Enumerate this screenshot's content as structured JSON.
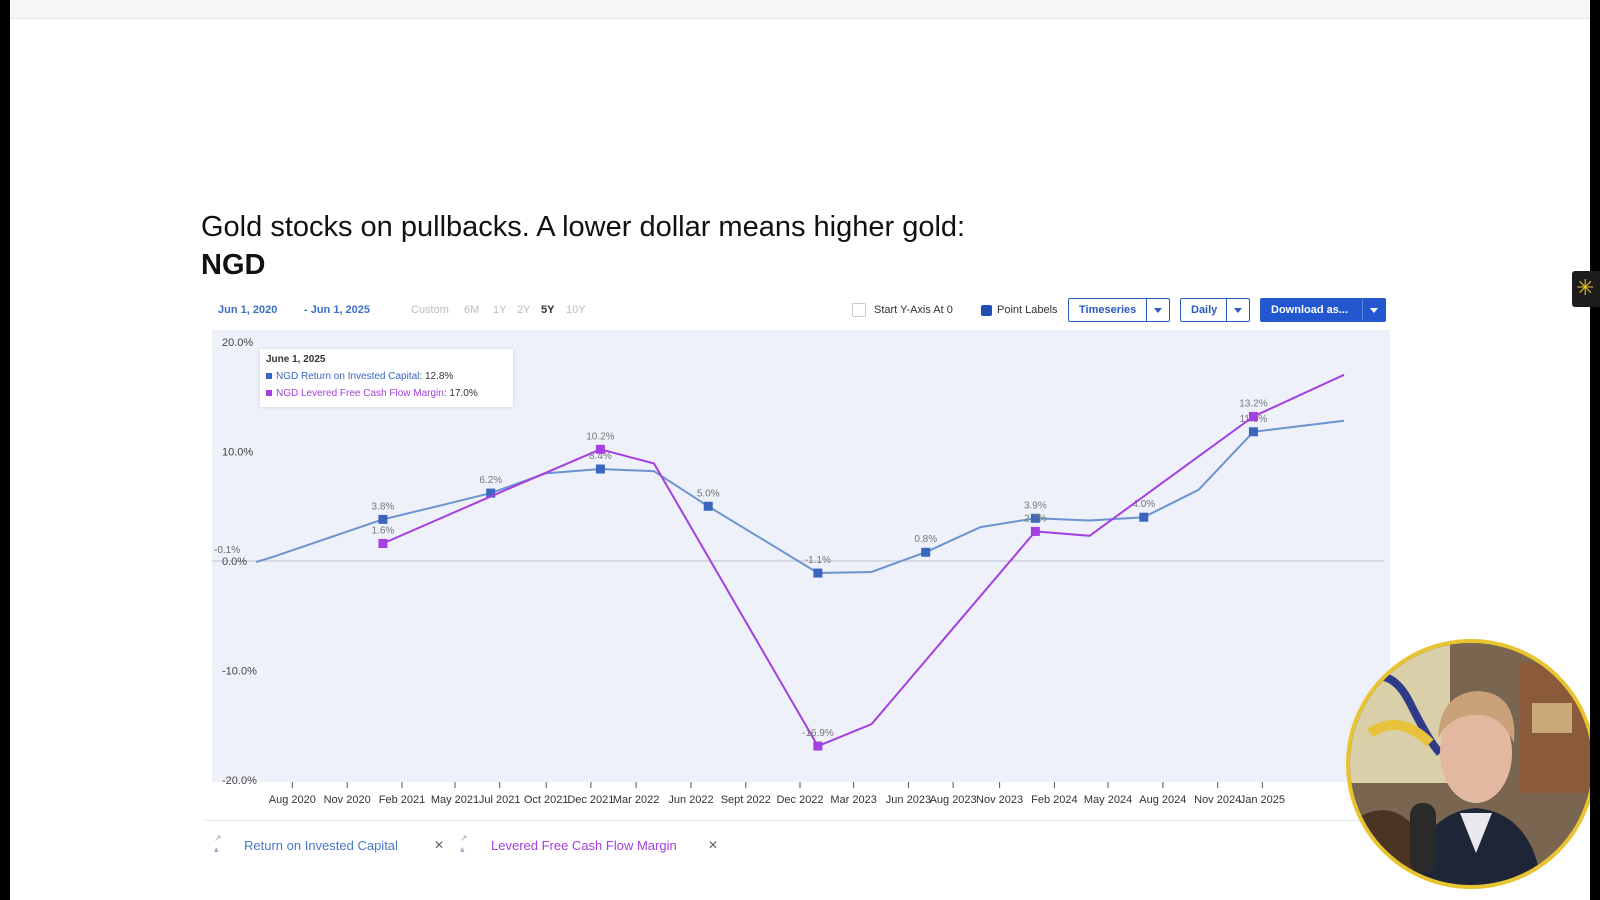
{
  "slide": {
    "headline": "Gold stocks on pullbacks.  A lower dollar means higher gold:",
    "ticker": "NGD"
  },
  "toolbar": {
    "date_start": "Jun 1, 2020",
    "date_end": "- Jun 1, 2025",
    "ranges": [
      {
        "label": "Custom",
        "active": false
      },
      {
        "label": "6M",
        "active": false
      },
      {
        "label": "1Y",
        "active": false
      },
      {
        "label": "2Y",
        "active": false
      },
      {
        "label": "5Y",
        "active": true
      },
      {
        "label": "10Y",
        "active": false
      }
    ],
    "start_y_axis_label": "Start Y-Axis At 0",
    "start_y_axis_checked": false,
    "point_labels_label": "Point Labels",
    "point_labels_checked": true,
    "view_mode": "Timeseries",
    "frequency": "Daily",
    "download": "Download as..."
  },
  "tooltip": {
    "date": "June 1, 2025",
    "rows": [
      {
        "name": "NGD Return on Invested Capital",
        "value": "12.8%"
      },
      {
        "name": "NGD Levered Free Cash Flow Margin",
        "value": "17.0%"
      }
    ]
  },
  "legend": [
    {
      "label": "Return on Invested Capital",
      "color": "#4a78c8"
    },
    {
      "label": "Levered Free Cash Flow Margin",
      "color": "#a43fe0"
    }
  ],
  "colors": {
    "roic": "#6b93cf",
    "roic_marker": "#3b66c0",
    "lfcf": "#a43fe0",
    "plot_bg": "#eef1f9",
    "accent": "#2257cf"
  },
  "icons": {
    "badge": "asterisk-icon",
    "close": "close-icon",
    "caret": "caret-down-icon"
  },
  "chart_data": {
    "type": "line",
    "xlim": [
      "2020-06-01",
      "2025-06-01"
    ],
    "ylim": [
      -20,
      20
    ],
    "yticks": [
      "20.0%",
      "10.0%",
      "0.0%",
      "-10.0%",
      "-20.0%"
    ],
    "xticks": [
      {
        "date": "2020-08-01",
        "label": "Aug 2020"
      },
      {
        "date": "2020-11-01",
        "label": "Nov 2020"
      },
      {
        "date": "2021-02-01",
        "label": "Feb 2021"
      },
      {
        "date": "2021-05-01",
        "label": "May 2021"
      },
      {
        "date": "2021-07-15",
        "label": "Jul 2021"
      },
      {
        "date": "2021-10-01",
        "label": "Oct 2021"
      },
      {
        "date": "2021-12-15",
        "label": "Dec 2021"
      },
      {
        "date": "2022-03-01",
        "label": "Mar 2022"
      },
      {
        "date": "2022-06-01",
        "label": "Jun 2022"
      },
      {
        "date": "2022-09-01",
        "label": "Sept 2022"
      },
      {
        "date": "2022-12-01",
        "label": "Dec 2022"
      },
      {
        "date": "2023-03-01",
        "label": "Mar 2023"
      },
      {
        "date": "2023-06-01",
        "label": "Jun 2023"
      },
      {
        "date": "2023-08-15",
        "label": "Aug 2023"
      },
      {
        "date": "2023-11-01",
        "label": "Nov 2023"
      },
      {
        "date": "2024-02-01",
        "label": "Feb 2024"
      },
      {
        "date": "2024-05-01",
        "label": "May 2024"
      },
      {
        "date": "2024-08-01",
        "label": "Aug 2024"
      },
      {
        "date": "2024-11-01",
        "label": "Nov 2024"
      },
      {
        "date": "2025-01-15",
        "label": "Jan 2025"
      }
    ],
    "series": [
      {
        "name": "Return on Invested Capital",
        "points": [
          {
            "x": "2020-06-01",
            "y": -0.1
          },
          {
            "x": "2020-07-01",
            "y": 0.4
          },
          {
            "x": "2020-12-31",
            "y": 3.8,
            "label": "3.8%",
            "marker": true
          },
          {
            "x": "2021-04-01",
            "y": 5.0
          },
          {
            "x": "2021-06-30",
            "y": 6.2,
            "label": "6.2%",
            "marker": true
          },
          {
            "x": "2021-09-30",
            "y": 8.0
          },
          {
            "x": "2021-12-31",
            "y": 8.4,
            "label": "8.4%",
            "marker": true
          },
          {
            "x": "2022-03-31",
            "y": 8.2
          },
          {
            "x": "2022-06-30",
            "y": 5.0,
            "label": "5.0%",
            "marker": true
          },
          {
            "x": "2022-12-31",
            "y": -1.1,
            "label": "-1.1%",
            "marker": true
          },
          {
            "x": "2023-03-31",
            "y": -1.0
          },
          {
            "x": "2023-06-30",
            "y": 0.8,
            "label": "0.8%",
            "marker": true
          },
          {
            "x": "2023-09-30",
            "y": 3.1
          },
          {
            "x": "2023-12-31",
            "y": 3.9,
            "label": "3.9%",
            "marker": true
          },
          {
            "x": "2024-03-31",
            "y": 3.7
          },
          {
            "x": "2024-06-30",
            "y": 4.0,
            "label": "4.0%",
            "marker": true
          },
          {
            "x": "2024-09-30",
            "y": 6.5
          },
          {
            "x": "2024-12-31",
            "y": 11.8,
            "label": "11.8%",
            "marker": true
          },
          {
            "x": "2025-06-01",
            "y": 12.8
          }
        ]
      },
      {
        "name": "Levered Free Cash Flow Margin",
        "points": [
          {
            "x": "2020-12-31",
            "y": 1.6,
            "label": "1.6%",
            "marker": true
          },
          {
            "x": "2021-06-30",
            "y": 5.9
          },
          {
            "x": "2021-12-31",
            "y": 10.2,
            "label": "10.2%",
            "marker": true
          },
          {
            "x": "2022-03-31",
            "y": 8.9
          },
          {
            "x": "2022-12-31",
            "y": -16.9,
            "label": "-16.9%",
            "marker": true
          },
          {
            "x": "2023-03-31",
            "y": -14.9
          },
          {
            "x": "2023-12-31",
            "y": 2.7,
            "label": "2.7%",
            "marker": true
          },
          {
            "x": "2024-03-31",
            "y": 2.3
          },
          {
            "x": "2024-12-31",
            "y": 13.2,
            "label": "13.2%",
            "marker": true
          },
          {
            "x": "2025-06-01",
            "y": 17.0
          }
        ]
      }
    ],
    "extra_labels": [
      {
        "y": -0.1,
        "label": "-0.1%"
      }
    ],
    "grid": "horizontal-zero-line",
    "legend_position": "bottom"
  }
}
